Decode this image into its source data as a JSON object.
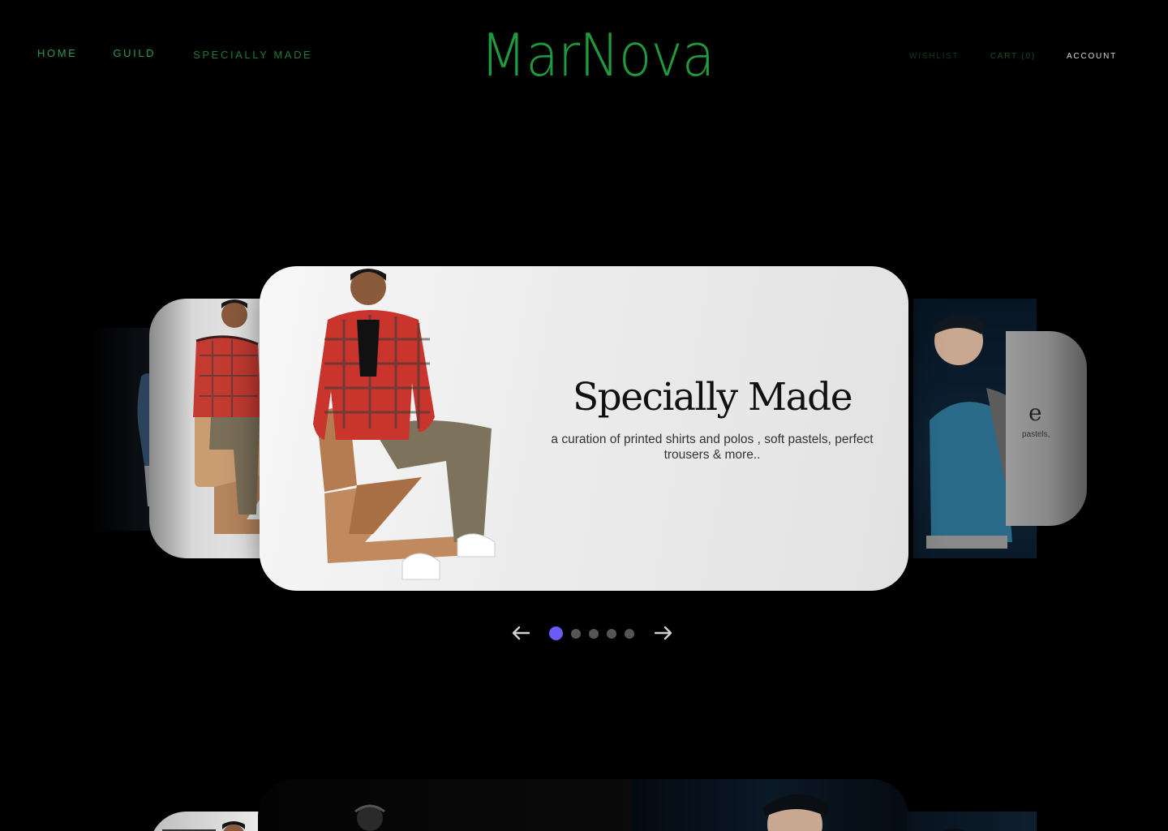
{
  "nav": {
    "left": [
      "HOME",
      "GUILD",
      "SPECIALLY MADE"
    ],
    "logo": "MarNova",
    "right": {
      "wishlist": "WISHLIST",
      "cart": "CART (0)",
      "account": "ACCOUNT"
    }
  },
  "hero": {
    "title": "Specially Made",
    "subtitle": "a curation of printed shirts and polos , soft pastels, perfect trousers & more.."
  },
  "side_card": {
    "title_fragment": "e",
    "subtitle_fragment": "pastels,"
  },
  "carousel": {
    "dots": 5,
    "active_dot": 1,
    "prev_icon": "arrow-left-icon",
    "next_icon": "arrow-right-icon"
  },
  "colors": {
    "brand_green": "#1f9a3f",
    "nav_green": "#2e9a49",
    "active_dot": "#6a5cf5",
    "background": "#000000"
  }
}
